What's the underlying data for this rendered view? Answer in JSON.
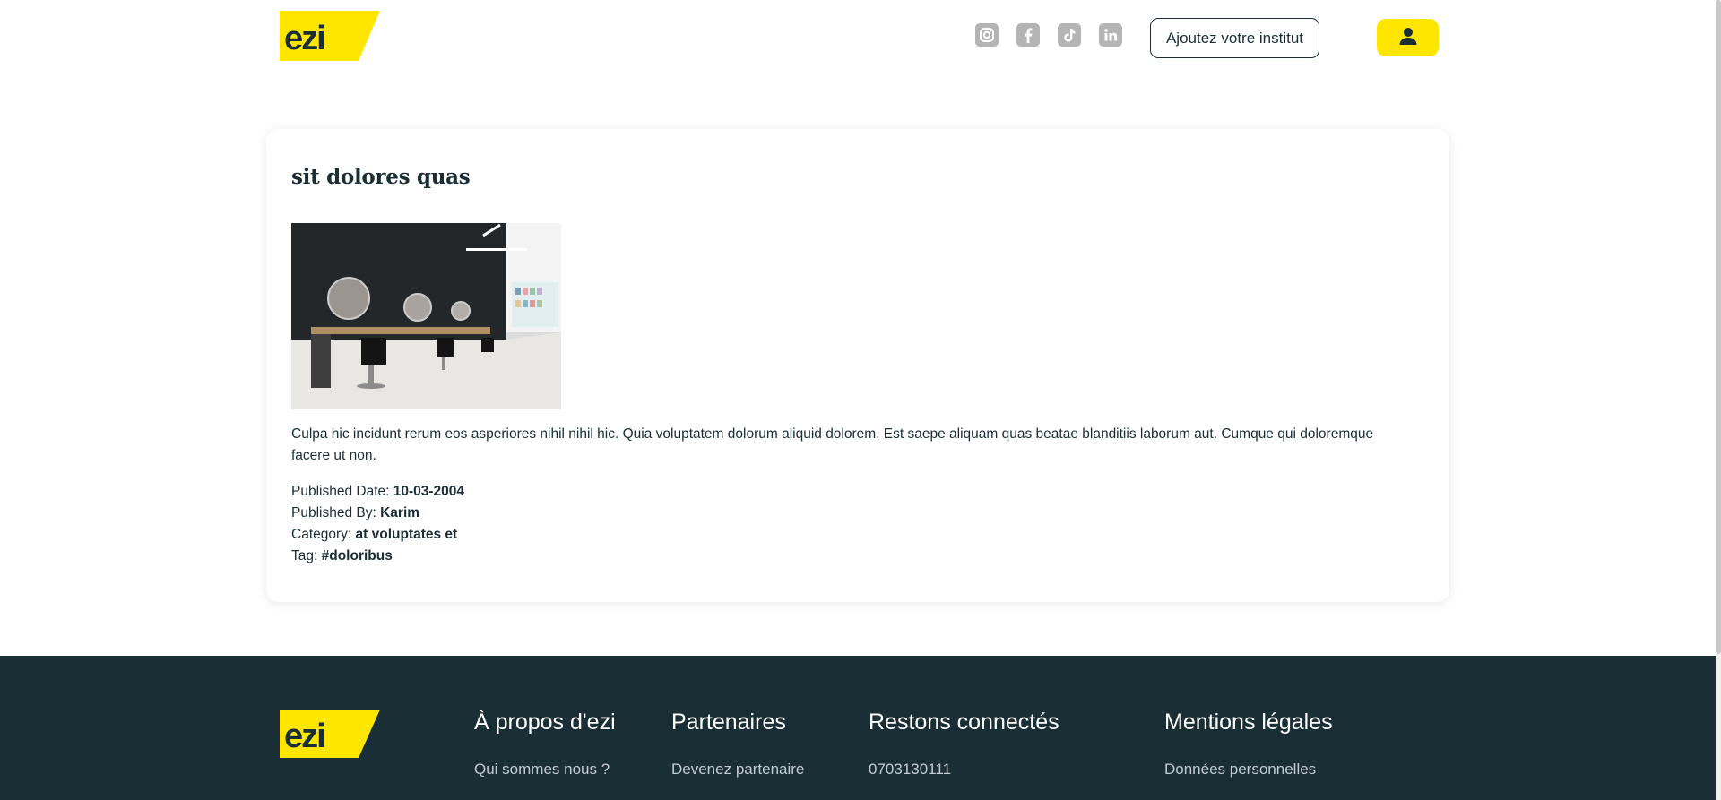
{
  "brand": {
    "logo_text": "ezi",
    "accent_color": "#ffe600",
    "dark_color": "#1a2e35"
  },
  "header": {
    "social_icons": [
      "instagram-icon",
      "facebook-icon",
      "tiktok-icon",
      "linkedin-icon"
    ],
    "add_institute_label": "Ajoutez votre institut",
    "user_icon": "user-icon"
  },
  "post": {
    "title": "sit dolores quas",
    "body": "Culpa hic incidunt rerum eos asperiores nihil nihil hic. Quia voluptatem dolorum aliquid dolorem. Est saepe aliquam quas beatae blanditiis laborum aut. Cumque qui doloremque facere ut non.",
    "meta": [
      {
        "label": "Published Date: ",
        "value": "10-03-2004"
      },
      {
        "label": "Published By: ",
        "value": "Karim"
      },
      {
        "label": "Category: ",
        "value": "at voluptates et"
      },
      {
        "label": "Tag: ",
        "value": "#doloribus"
      }
    ]
  },
  "footer": {
    "columns": [
      {
        "heading": "À propos d'ezi",
        "link": "Qui sommes nous ?"
      },
      {
        "heading": "Partenaires",
        "link": "Devenez partenaire"
      },
      {
        "heading": "Restons connectés",
        "link": "0703130111"
      },
      {
        "heading": "Mentions légales",
        "link": "Données personnelles"
      }
    ]
  }
}
